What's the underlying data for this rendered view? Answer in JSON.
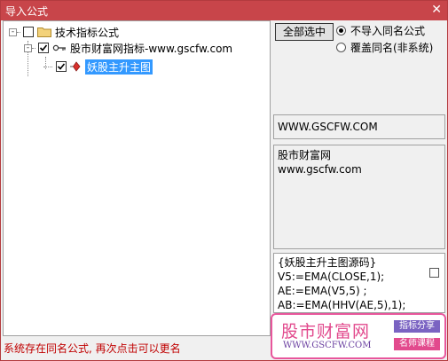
{
  "window": {
    "title": "导入公式",
    "close_glyph": "✕"
  },
  "tree": {
    "root": {
      "label": "技术指标公式",
      "expander": "-",
      "checked": false
    },
    "group": {
      "label": "股市财富网指标-www.gscfw.com",
      "expander": "-",
      "checked": true,
      "icon": "key-icon"
    },
    "item": {
      "label": "妖股主升主图",
      "checked": true,
      "selected": true,
      "icon": "formula-icon"
    }
  },
  "controls": {
    "select_all_label": "全部选中",
    "radio_options": [
      {
        "label": "不导入同名公式",
        "selected": true
      },
      {
        "label": "覆盖同名(非系统)",
        "selected": false
      }
    ]
  },
  "info": {
    "url": "WWW.GSCFW.COM",
    "description_lines": [
      "股市财富网",
      "www.gscfw.com"
    ]
  },
  "source": {
    "lines": [
      "{妖股主升主图源码}",
      "V5:=EMA(CLOSE,1);",
      "AE:=EMA(V5,5) ;",
      "AB:=EMA(HHV(AE,5),1);"
    ]
  },
  "status": "系统存在同名公式, 再次点击可以更名",
  "watermark": {
    "brand": "股市财富网",
    "url": "WWW.GSCFW.COM",
    "tag1": "指标分享",
    "tag2": "名师课程",
    "colors": {
      "pink": "#e24a8d",
      "purple": "#7a63c2"
    }
  },
  "colors": {
    "titlebar": "#c8454a",
    "selection": "#3399ff",
    "status": "#c00000"
  }
}
